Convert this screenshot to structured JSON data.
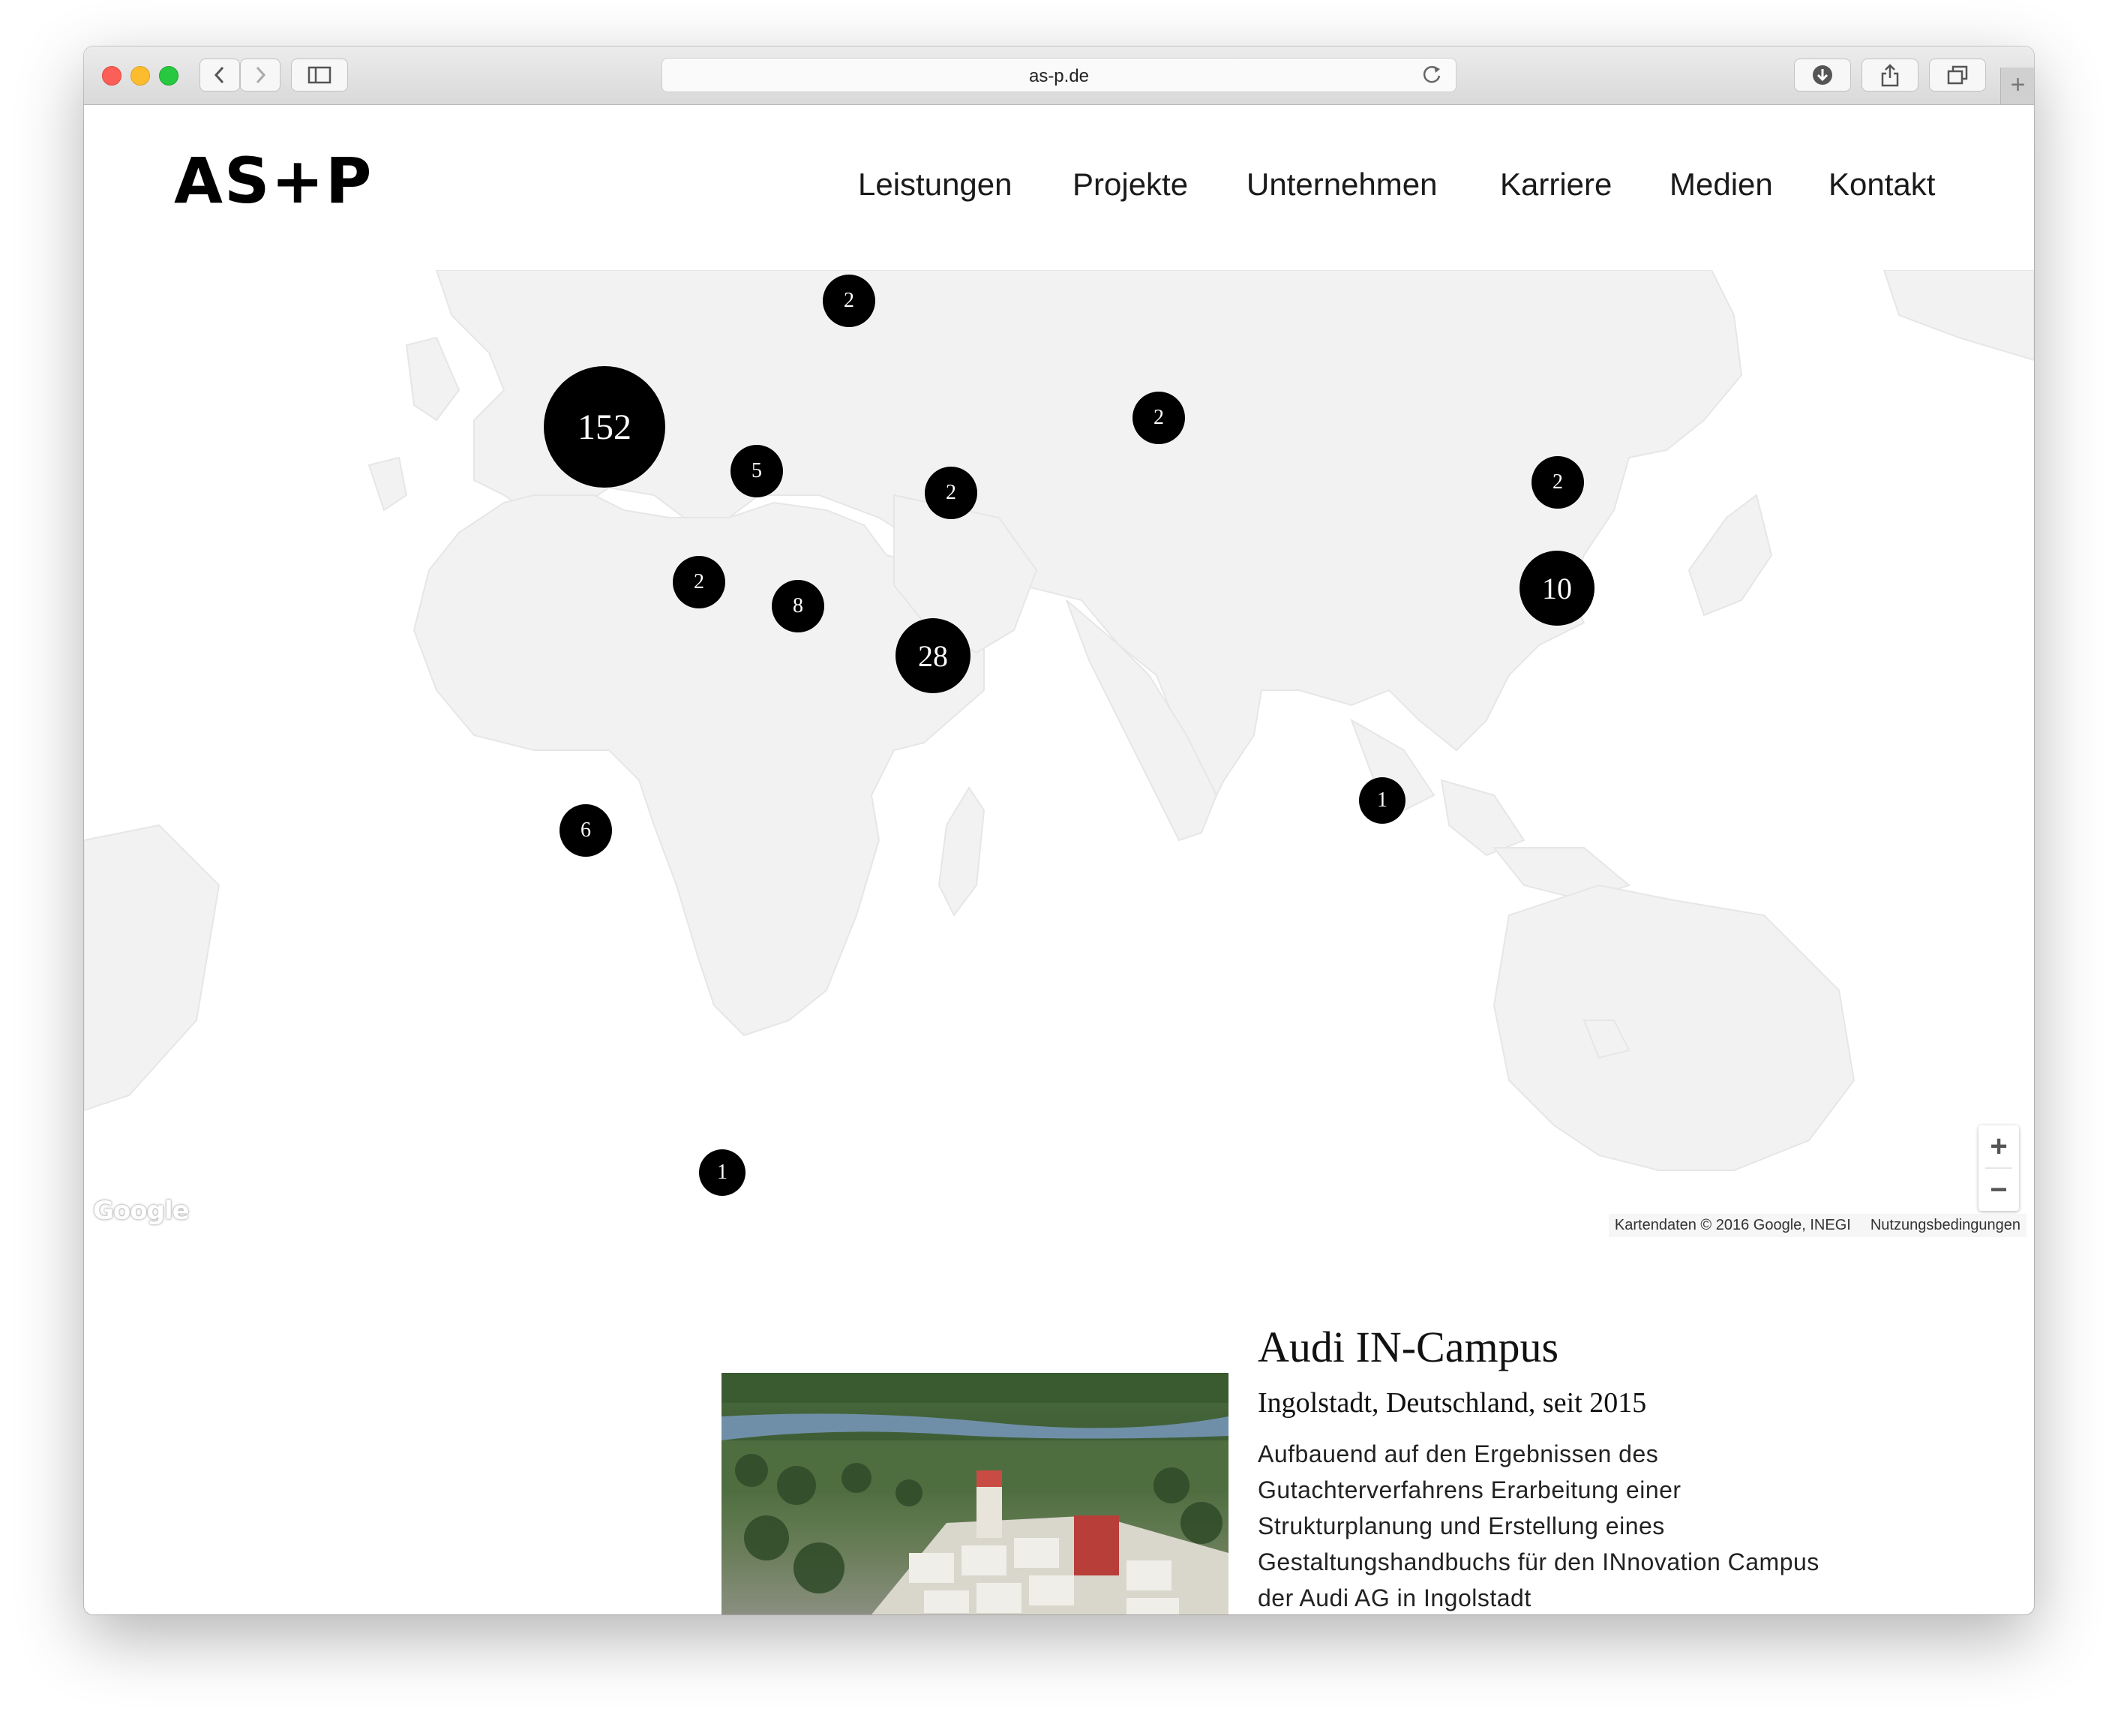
{
  "browser": {
    "url": "as-p.de",
    "new_tab_symbol": "+",
    "icons": [
      "back-icon",
      "forward-icon",
      "sidebar-icon",
      "reload-icon",
      "download-icon",
      "share-icon",
      "tabs-icon"
    ]
  },
  "header": {
    "logo": "AS+P",
    "nav": [
      "Leistungen",
      "Projekte",
      "Unternehmen",
      "Karriere",
      "Medien",
      "Kontakt"
    ]
  },
  "map": {
    "markers": [
      "2",
      "152",
      "2",
      "2",
      "5",
      "2",
      "2",
      "10",
      "8",
      "28",
      "1",
      "6",
      "1"
    ],
    "zoom_in": "+",
    "zoom_out": "−",
    "google_logo": "Google",
    "attribution": "Kartendaten © 2016 Google, INEGI",
    "terms": "Nutzungsbedingungen",
    "land_color": "#f2f2f2",
    "marker_color": "#000000"
  },
  "project": {
    "title": "Audi IN-Campus",
    "subtitle": "Ingolstadt, Deutschland, seit 2015",
    "description": "Aufbauend auf den Ergebnissen des Gutachterverfahrens Erarbeitung einer Strukturplanung und Erstellung eines Gestaltungshandbuchs für den INnovation Campus der Audi AG in Ingolstadt"
  }
}
